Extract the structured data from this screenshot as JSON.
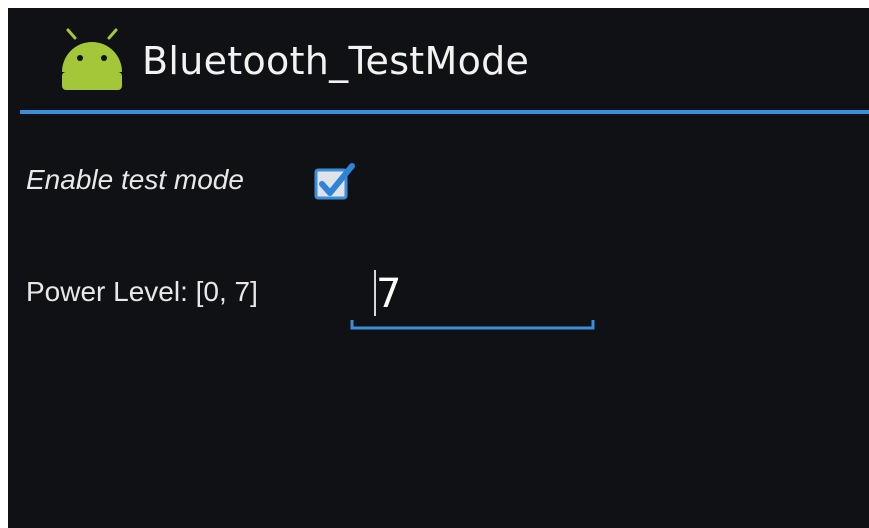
{
  "app": {
    "title": "Bluetooth_TestMode",
    "icon": "android-icon",
    "accent_color": "#3a8edc",
    "icon_color": "#a4c639"
  },
  "settings": {
    "enable_test_mode": {
      "label": "Enable test mode",
      "checked": true
    },
    "power_level": {
      "label": "Power Level: [0, 7]",
      "value": "7"
    }
  }
}
